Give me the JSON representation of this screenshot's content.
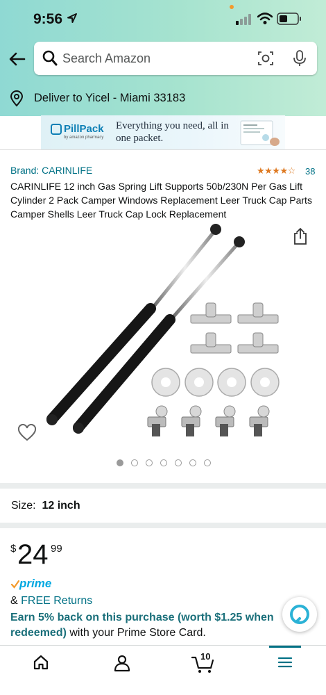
{
  "status_bar": {
    "time": "9:56"
  },
  "search": {
    "placeholder": "Search Amazon"
  },
  "deliver": {
    "text": "Deliver to Yicel - Miami 33183"
  },
  "banner": {
    "logo_text": "PillPack",
    "logo_subtext": "by amazon pharmacy",
    "tagline": "Everything you need, all in one packet."
  },
  "product": {
    "brand": "Brand: CARINLIFE",
    "stars_display": "★★★★☆",
    "rating": 4.5,
    "rating_count": "38",
    "title": "CARINLIFE 12 inch Gas Spring Lift Supports 50b/230N Per Gas Lift Cylinder 2 Pack Camper Windows Replacement Leer Truck Cap Parts Camper Shells Leer Truck Cap Lock Replacement",
    "image_count": 7,
    "active_image": 1
  },
  "size": {
    "label": "Size:",
    "value": "12 inch"
  },
  "price": {
    "symbol": "$",
    "whole": "24",
    "fraction": "99"
  },
  "prime": {
    "label": "prime"
  },
  "returns": {
    "prefix": "& ",
    "link": "FREE Returns"
  },
  "earn": {
    "bold": "Earn 5% back on this purchase (worth $1.25 when redeemed)",
    "rest": " with your Prime Store Card."
  },
  "bottom_nav": {
    "cart_count": "10"
  },
  "colors": {
    "link": "#007185",
    "star": "#de7921",
    "prime": "#00a8e1",
    "header_start": "#8fd9d3",
    "header_end": "#c1ecd6"
  }
}
